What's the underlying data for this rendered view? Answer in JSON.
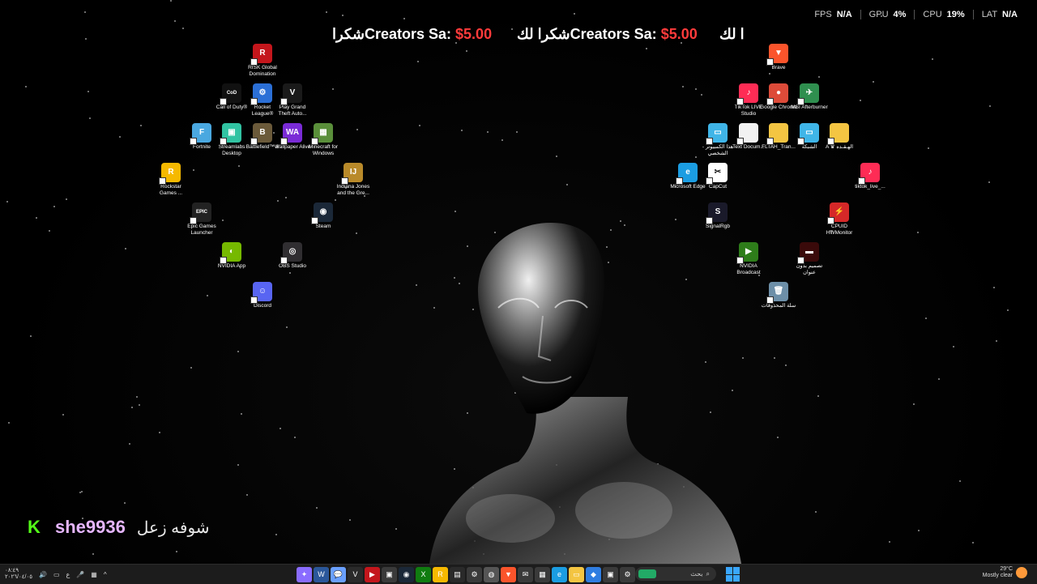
{
  "overlay": {
    "fps_label": "FPS",
    "fps_value": "N/A",
    "gpu_label": "GPU",
    "gpu_value": "4%",
    "cpu_label": "CPU",
    "cpu_value": "19%",
    "lat_label": "LAT",
    "lat_value": "N/A"
  },
  "ticker": {
    "seg1_text": "شكرا",
    "seg1_name": "Creators Sa:",
    "seg1_amount": "$5.00",
    "seg2_text": "شكرا لك",
    "seg2_name": "Creators Sa:",
    "seg2_amount": "$5.00",
    "seg3_text": "ا لك"
  },
  "desktop_icons": [
    {
      "label": "RISK Global Domination",
      "icon": "risk-icon",
      "color": "#c4161c",
      "glyph": "R"
    },
    {
      "label": "Call of Duty®",
      "icon": "call-of-duty-icon",
      "color": "#111111",
      "glyph": "CoD"
    },
    {
      "label": "Rocket League®",
      "icon": "rocket-league-icon",
      "color": "#2b6fd6",
      "glyph": "⚙"
    },
    {
      "label": "Play Grand Theft Auto...",
      "icon": "gta-icon",
      "color": "#1a1a1a",
      "glyph": "V"
    },
    {
      "label": "Fortnite",
      "icon": "fortnite-icon",
      "color": "#4aa8e0",
      "glyph": "F"
    },
    {
      "label": "Streamlabs Desktop",
      "icon": "streamlabs-icon",
      "color": "#31c3a2",
      "glyph": "▣"
    },
    {
      "label": "Battlefield™ 6",
      "icon": "battlefield-icon",
      "color": "#6b5a3a",
      "glyph": "B"
    },
    {
      "label": "Wallpaper Alive",
      "icon": "wallpaper-alive-icon",
      "color": "#7a2bd6",
      "glyph": "WA"
    },
    {
      "label": "Minecraft for Windows",
      "icon": "minecraft-icon",
      "color": "#5a8f3a",
      "glyph": "▦"
    },
    {
      "label": "Rockstar Games ...",
      "icon": "rockstar-icon",
      "color": "#f6b900",
      "glyph": "R"
    },
    {
      "label": "Indiana Jones and the Gre...",
      "icon": "indiana-jones-icon",
      "color": "#b98a2a",
      "glyph": "IJ"
    },
    {
      "label": "Epic Games Launcher",
      "icon": "epic-games-icon",
      "color": "#222222",
      "glyph": "EPIC"
    },
    {
      "label": "Steam",
      "icon": "steam-icon",
      "color": "#1b2838",
      "glyph": "◉"
    },
    {
      "label": "NVIDIA App",
      "icon": "nvidia-icon",
      "color": "#76b900",
      "glyph": "◐"
    },
    {
      "label": "OBS Studio",
      "icon": "obs-icon",
      "color": "#302e31",
      "glyph": "◎"
    },
    {
      "label": "Discord",
      "icon": "discord-icon",
      "color": "#5865f2",
      "glyph": "☺"
    },
    {
      "label": "Brave",
      "icon": "brave-icon",
      "color": "#fb542b",
      "glyph": "▼"
    },
    {
      "label": "TikTok LIVE Studio",
      "icon": "tiktok-live-icon",
      "color": "#fe2c55",
      "glyph": "♪"
    },
    {
      "label": "Google Chrome",
      "icon": "chrome-icon",
      "color": "#dd4b39",
      "glyph": "●"
    },
    {
      "label": "MSI Afterburner",
      "icon": "msi-afterburner-icon",
      "color": "#2f8f4f",
      "glyph": "✈"
    },
    {
      "label": "هذا الكمبيوتر - الشخصي",
      "icon": "this-pc-icon",
      "color": "#3fb5e8",
      "glyph": "▭"
    },
    {
      "label": "Text Docum...",
      "icon": "text-document-icon",
      "color": "#f2f2f2",
      "glyph": ""
    },
    {
      "label": "FLTAH_Tran...",
      "icon": "folder-icon",
      "color": "#f4c542",
      "glyph": ""
    },
    {
      "label": "الشبكة",
      "icon": "network-icon",
      "color": "#3fb5e8",
      "glyph": "▭"
    },
    {
      "label": "A ♛ الهـقـده",
      "icon": "folder-icon",
      "color": "#f4c542",
      "glyph": ""
    },
    {
      "label": "Microsoft Edge",
      "icon": "edge-icon",
      "color": "#1b9de2",
      "glyph": "e"
    },
    {
      "label": "CapCut",
      "icon": "capcut-icon",
      "color": "#ffffff",
      "glyph": "✂"
    },
    {
      "label": "tiktok_live_...",
      "icon": "tiktok-icon",
      "color": "#fe2c55",
      "glyph": "♪"
    },
    {
      "label": "SignalRgb",
      "icon": "signalrgb-icon",
      "color": "#1a1a2a",
      "glyph": "S"
    },
    {
      "label": "CPUID HWMonitor",
      "icon": "hwmonitor-icon",
      "color": "#d62828",
      "glyph": "⚡"
    },
    {
      "label": "NVIDIA Broadcast",
      "icon": "nvidia-broadcast-icon",
      "color": "#2e7d1a",
      "glyph": "▶"
    },
    {
      "label": "تصميم بدون عنوان",
      "icon": "design-image-icon",
      "color": "#3a0a0a",
      "glyph": "▬"
    },
    {
      "label": "سلة المحذوفات",
      "icon": "recycle-bin-icon",
      "color": "#6d8fa8",
      "glyph": "🗑"
    }
  ],
  "kick": {
    "username": "she9936",
    "message": "شوفه زعل"
  },
  "taskbar": {
    "time": "٠٨:٤٩",
    "date": "٢٠٢٦/٠٤/٠٥",
    "lang": "ع",
    "search_placeholder": "بحث",
    "weather_temp": "29°C",
    "weather_desc": "Mostly clear",
    "apps": [
      {
        "icon": "copilot-icon",
        "color": "#8a6cff",
        "glyph": "✦"
      },
      {
        "icon": "word-icon",
        "color": "#2b579a",
        "glyph": "W"
      },
      {
        "icon": "chat-icon",
        "color": "#6aa0ff",
        "glyph": "💬"
      },
      {
        "icon": "gta-icon",
        "color": "#2a2a2a",
        "glyph": "V"
      },
      {
        "icon": "rec-icon",
        "color": "#c4161c",
        "glyph": "▶"
      },
      {
        "icon": "chat-bubble-icon",
        "color": "#3a3a3a",
        "glyph": "▣"
      },
      {
        "icon": "steam-icon",
        "color": "#1b2838",
        "glyph": "◉"
      },
      {
        "icon": "xbox-icon",
        "color": "#107c10",
        "glyph": "X"
      },
      {
        "icon": "rockstar-icon",
        "color": "#f6b900",
        "glyph": "R"
      },
      {
        "icon": "terminal-icon",
        "color": "#2a2a2a",
        "glyph": "▤"
      },
      {
        "icon": "settings-icon",
        "color": "#3a3a3a",
        "glyph": "⚙"
      },
      {
        "icon": "fortnite-icon",
        "color": "#555555",
        "glyph": "◍"
      },
      {
        "icon": "brave-icon",
        "color": "#fb542b",
        "glyph": "▼"
      },
      {
        "icon": "mail-icon",
        "color": "#3a3a3a",
        "glyph": "✉"
      },
      {
        "icon": "calculator-icon",
        "color": "#3a3a3a",
        "glyph": "▦"
      },
      {
        "icon": "edge-icon",
        "color": "#1b9de2",
        "glyph": "e"
      },
      {
        "icon": "file-explorer-icon",
        "color": "#f4c542",
        "glyph": "▭"
      },
      {
        "icon": "photos-icon",
        "color": "#2f7de1",
        "glyph": "◆"
      },
      {
        "icon": "store-icon",
        "color": "#3a3a3a",
        "glyph": "▣"
      },
      {
        "icon": "gear-icon",
        "color": "#3a3a3a",
        "glyph": "⚙"
      }
    ]
  }
}
